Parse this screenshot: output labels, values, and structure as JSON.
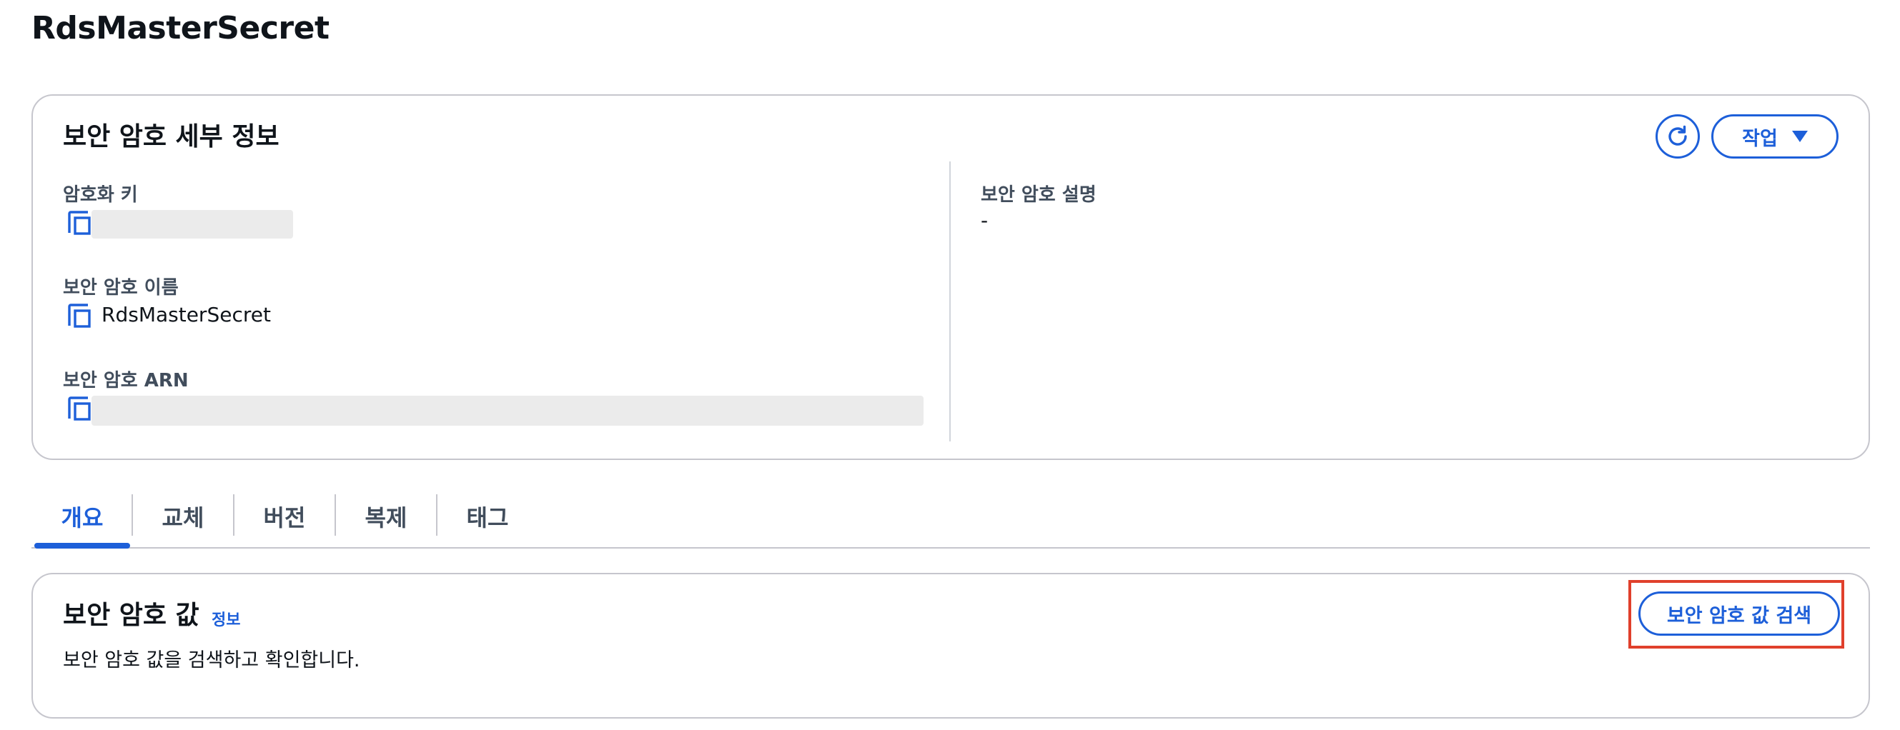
{
  "page": {
    "title": "RdsMasterSecret"
  },
  "details": {
    "heading": "보안 암호 세부 정보",
    "encryption_key_label": "암호화 키",
    "secret_name_label": "보안 암호 이름",
    "secret_name_value": "RdsMasterSecret",
    "secret_arn_label": "보안 암호 ARN",
    "description_label": "보안 암호 설명",
    "description_value": "-",
    "actions_label": "작업"
  },
  "tabs": [
    {
      "label": "개요",
      "active": true
    },
    {
      "label": "교체",
      "active": false
    },
    {
      "label": "버전",
      "active": false
    },
    {
      "label": "복제",
      "active": false
    },
    {
      "label": "태그",
      "active": false
    }
  ],
  "secret_value": {
    "heading": "보안 암호 값",
    "info_link": "정보",
    "description": "보안 암호 값을 검색하고 확인합니다.",
    "retrieve_button": "보안 암호 값 검색"
  },
  "colors": {
    "accent": "#1d5fd9",
    "highlight": "#e0402c",
    "border": "#c6c6cd"
  },
  "icons": {
    "copy": "copy-icon",
    "refresh": "refresh-icon",
    "dropdown": "caret-down-icon"
  }
}
